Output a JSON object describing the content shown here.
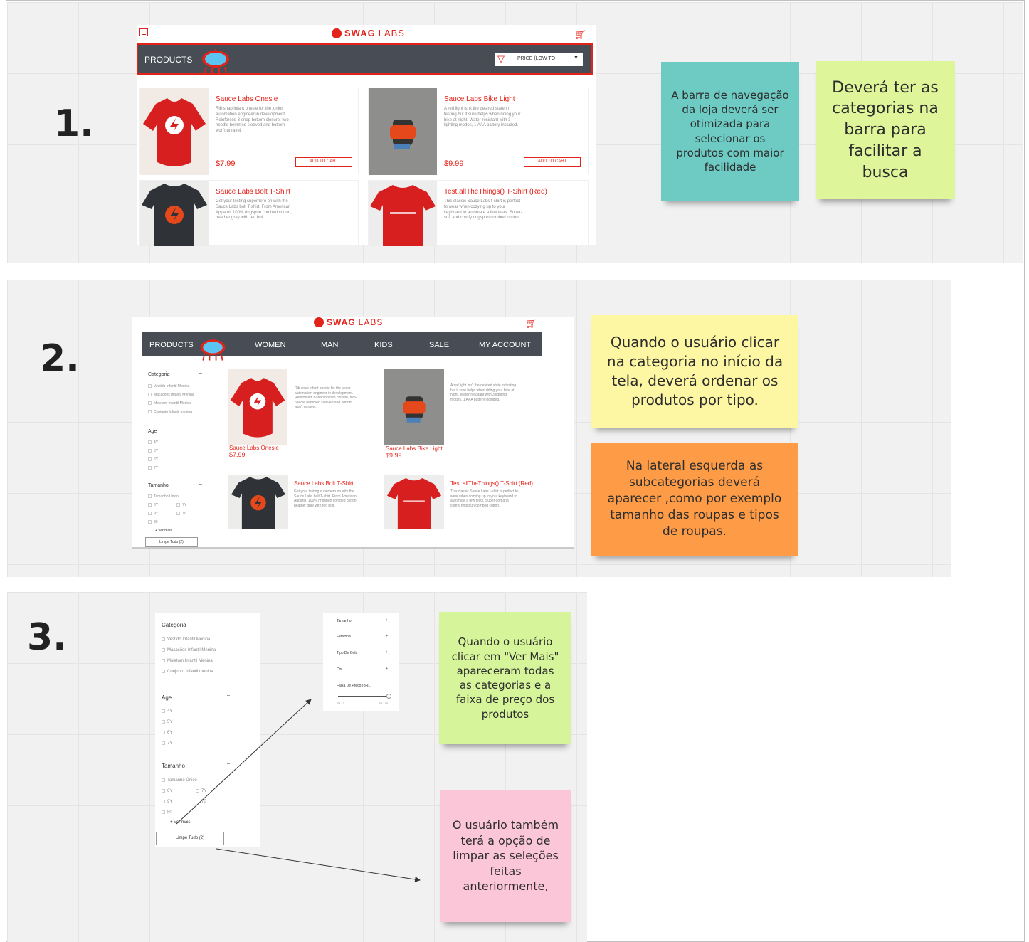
{
  "section1": {
    "number": "1.",
    "brand_prefix": "SWAG",
    "brand_suffix": "LABS",
    "products_label": "PRODUCTS",
    "sort_label": "PRICE (LOW TO",
    "products": [
      {
        "name": "Sauce Labs Onesie",
        "desc": "Rib snap infant onesie for the junior automation engineer in development. Reinforced 3-snap bottom closure, two-needle hemmed sleeved and bottom won't unravel.",
        "price": "$7.99",
        "button": "ADD TO CART"
      },
      {
        "name": "Sauce Labs Bike Light",
        "desc": "A red light isn't the desired state in testing but it sure helps when riding your bike at night. Water-resistant with 3 lighting modes, 1 AAA battery included.",
        "price": "$9.99",
        "button": "ADD TO CART"
      },
      {
        "name": "Sauce Labs Bolt T-Shirt",
        "desc": "Get your testing superhero on with the Sauce Labs bolt T-shirt. From American Apparel, 100% ringspun combed cotton, heather gray with red bolt."
      },
      {
        "name": "Test.allTheThings() T-Shirt (Red)",
        "desc": "This classic Sauce Labs t-shirt is perfect to wear when cozying up to your keyboard to automate a few tests. Super-soft and comfy ringspun combed cotton."
      }
    ],
    "notes": [
      {
        "text": "A barra de navegação da loja deverá ser otimizada para selecionar os produtos com maior facilidade",
        "color": "#6ecbc4"
      },
      {
        "text": "Deverá ter as categorias na barra para facilitar a busca",
        "color": "#def59a"
      }
    ]
  },
  "section2": {
    "number": "2.",
    "brand_prefix": "SWAG",
    "brand_suffix": "LABS",
    "nav": [
      "PRODUCTS",
      "WOMEN",
      "MAN",
      "KIDS",
      "SALE",
      "MY ACCOUNT"
    ],
    "sidebar": {
      "categoria_title": "Categoria",
      "categorias": [
        "Vestido Infantil Menina",
        "Macacões Infantil Menina",
        "Moletom Infantil Menina",
        "Conjunto Infantil menina"
      ],
      "age_title": "Age",
      "ages": [
        "4Y",
        "5Y",
        "6Y",
        "7Y"
      ],
      "tamanho_title": "Tamanho",
      "tamanho_unico": "Tamanho Único",
      "tamanhos_left": [
        "6Y",
        "9Y",
        "80"
      ],
      "tamanhos_right": [
        "7Y",
        "70"
      ],
      "ver_mais": "+ Ver mais",
      "limpe": "Limpe Tudo (2)"
    },
    "products": [
      {
        "name": "Sauce Labs Onesie",
        "price": "$7.99",
        "desc": "Rib snap infant onesie for the junior automation engineer in development. Reinforced 3-snap bottom closure, two-needle hemmed sleeved and bottom won't unravel."
      },
      {
        "name": "Sauce Labs Bike Light",
        "price": "$9.99",
        "desc": "A red light isn't the desired state in testing but it sure helps when riding your bike at night. Water-resistant with 3 lighting modes, 1 AAA battery included."
      },
      {
        "name": "Sauce Labs Bolt T-Shirt",
        "desc": "Get your testing superhero on with the Sauce Labs bolt T-shirt. From American Apparel, 100% ringspun combed cotton, heather gray with red bolt."
      },
      {
        "name": "Test.allTheThings() T-Shirt (Red)",
        "desc": "This classic Sauce Labs t-shirt is perfect to wear when cozying up to your keyboard to automate a few tests. Super-soft and comfy ringspun combed cotton."
      }
    ],
    "notes": [
      {
        "text": "Quando o usuário clicar na categoria no início da tela, deverá ordenar os produtos por tipo.",
        "color": "#fdf6a3"
      },
      {
        "text": "Na lateral esquerda as subcategorias deverá aparecer ,como por exemplo tamanho das roupas e tipos de roupas.",
        "color": "#fd9b46"
      }
    ]
  },
  "section3": {
    "number": "3.",
    "sidebar": {
      "categoria_title": "Categoria",
      "categorias": [
        "Vestido Infantil Menina",
        "Macacões Infantil Menina",
        "Moletom Infantil Menina",
        "Conjunto Infantil menina"
      ],
      "age_title": "Age",
      "ages": [
        "4Y",
        "5Y",
        "6Y",
        "7Y"
      ],
      "tamanho_title": "Tamanho",
      "tamanho_unico": "Tamanho Único",
      "tamanhos_left": [
        "6Y",
        "9Y",
        "80"
      ],
      "tamanhos_right": [
        "7Y",
        "70"
      ],
      "ver_mais": "+ Ver mais",
      "limpe": "Limpe Tudo (2)"
    },
    "filters": [
      "Tamanho",
      "Estampa",
      "Tipo De Gola",
      "Cor"
    ],
    "price_title": "Faixa De Preço (BRL)",
    "price_min": "R$ 17",
    "price_max": "R$ 179",
    "notes": [
      {
        "text": "Quando o usuário clicar em \"Ver Mais\" apareceram todas as categorias e a faixa de preço dos produtos",
        "color": "#d6f59a"
      },
      {
        "text": "O usuário também terá a opção de limpar as seleções feitas anteriormente,",
        "color": "#fcc6d9"
      }
    ]
  }
}
